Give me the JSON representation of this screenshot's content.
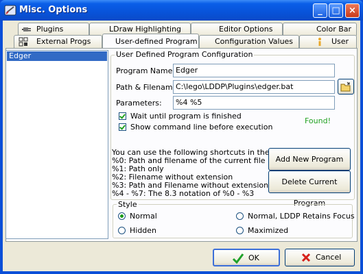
{
  "window": {
    "title": "Misc. Options"
  },
  "title_buttons": {
    "minimize": "_",
    "maximize": "□",
    "close": "×"
  },
  "tabs": {
    "row_back": [
      "Plugins",
      "LDraw Highlighting",
      "Editor Options",
      "Color Bar"
    ],
    "row_front": [
      "External Progs",
      "User-defined Program",
      "Configuration Values",
      "User"
    ]
  },
  "program_list": {
    "items": [
      "Edger"
    ]
  },
  "config": {
    "group_label": "User Defined Program Configuration",
    "name_label": "Program Name",
    "name_value": "Edger",
    "path_label": "Path & Filename:",
    "path_value": "C:\\lego\\LDDP\\Plugins\\edger.bat",
    "params_label": "Parameters:",
    "params_value": "%4  %5",
    "wait_label": "Wait until program is finished",
    "show_cmd_label": "Show command line before execution",
    "found_text": "Found!"
  },
  "help": {
    "lines": [
      "You can use the following shortcuts in the parameters:",
      "%0: Path and filename of the current file",
      "%1: Path only",
      "%2: Filename without extension",
      "%3: Path and Filename without extension",
      "%4 - %7: The 8.3 notation of %0 - %3"
    ]
  },
  "actions": {
    "add": "Add New Program",
    "delete": "Delete Current Program"
  },
  "style": {
    "label": "Style",
    "normal": "Normal",
    "normal_retains": "Normal, LDDP Retains Focus",
    "hidden": "Hidden",
    "maximized": "Maximized",
    "selected": "Normal"
  },
  "footer": {
    "ok": "OK",
    "cancel": "Cancel"
  },
  "colors": {
    "titlebar": "#0853d9",
    "accent_green": "#21a121",
    "selection": "#316ac5"
  }
}
